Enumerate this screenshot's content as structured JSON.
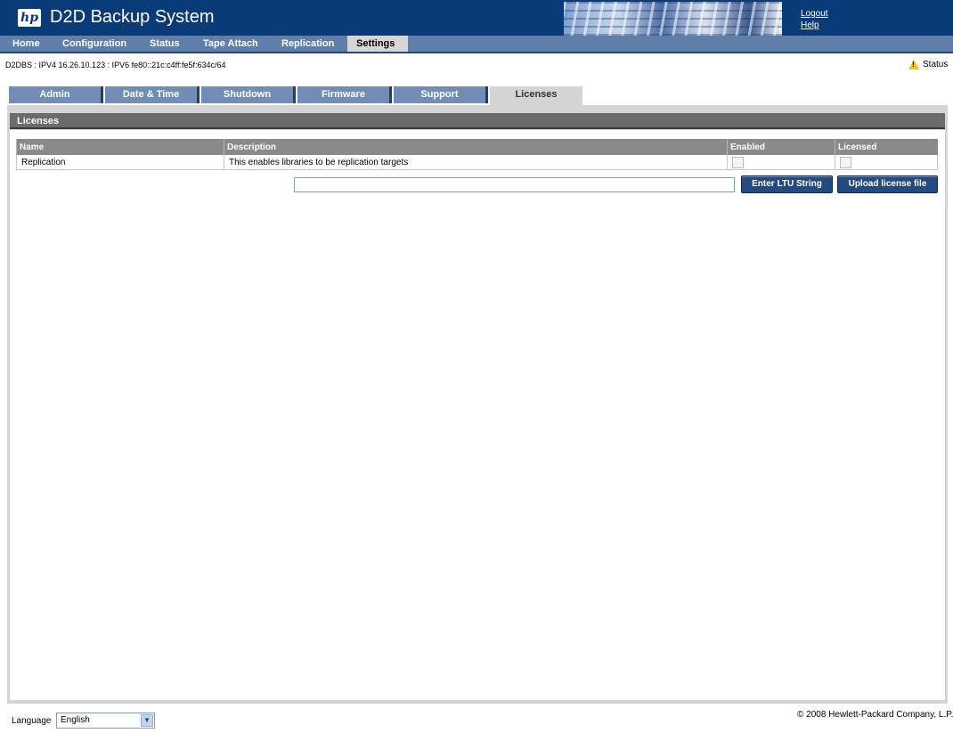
{
  "header": {
    "logo_text": "hp",
    "title": "D2D Backup System",
    "logout": "Logout",
    "help": "Help"
  },
  "nav": {
    "items": [
      "Home",
      "Configuration",
      "Status",
      "Tape Attach",
      "Replication",
      "Settings"
    ],
    "active": "Settings"
  },
  "info": {
    "address_line": "D2DBS : IPV4 16.26.10.123 : IPV6 fe80::21c:c4ff:fe5f:634c/64",
    "status_label": "Status",
    "status_icon": "warning-icon"
  },
  "tabs": {
    "items": [
      "Admin",
      "Date & Time",
      "Shutdown",
      "Firmware",
      "Support",
      "Licenses"
    ],
    "active": "Licenses"
  },
  "panel": {
    "title": "Licenses",
    "table": {
      "headers": [
        "Name",
        "Description",
        "Enabled",
        "Licensed"
      ],
      "rows": [
        {
          "name": "Replication",
          "description": "This enables libraries to be replication targets",
          "enabled": false,
          "licensed": false
        }
      ]
    },
    "ltu_input_value": "",
    "enter_ltu_button": "Enter LTU String",
    "upload_button": "Upload license file"
  },
  "footer": {
    "language_label": "Language",
    "language_selected": "English",
    "copyright": "© 2008 Hewlett-Packard Company, L.P."
  },
  "colors": {
    "header_bg": "#0a3b79",
    "nav_bg": "#5f7fa9",
    "tab_bg": "#6f8db5",
    "button_bg": "#254a7d"
  }
}
